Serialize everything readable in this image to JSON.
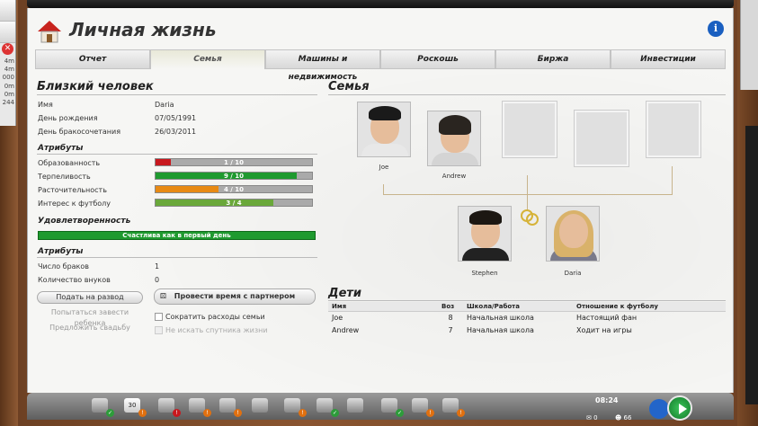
{
  "sidebar_left": {
    "nums": [
      "4m",
      "4m",
      "000",
      "0m",
      "0m",
      "244"
    ]
  },
  "page": {
    "title": "Личная жизнь"
  },
  "tabs": [
    "Отчет",
    "Семья",
    "Машины и недвижимость",
    "Роскошь",
    "Биржа",
    "Инвестиции"
  ],
  "partner": {
    "header": "Близкий человек",
    "rows": [
      {
        "label": "Имя",
        "value": "Daria"
      },
      {
        "label": "День рождения",
        "value": "07/05/1991"
      },
      {
        "label": "День бракосочетания",
        "value": "26/03/2011"
      }
    ],
    "attributes_title": "Атрибуты",
    "attributes": [
      {
        "label": "Образованность",
        "text": "1 / 10",
        "fraction": 0.1,
        "color": "#c8181e"
      },
      {
        "label": "Терпеливость",
        "text": "9 / 10",
        "fraction": 0.9,
        "color": "#1f9a2f"
      },
      {
        "label": "Расточительность",
        "text": "4 / 10",
        "fraction": 0.4,
        "color": "#e88a14"
      },
      {
        "label": "Интерес к футболу",
        "text": "3 / 4",
        "fraction": 0.75,
        "color": "#6aa83a"
      }
    ],
    "satisfaction_title": "Удовлетворенность",
    "satisfaction_text": "Счастлива как в первый день",
    "attributes2_title": "Атрибуты",
    "rows2": [
      {
        "label": "Число браков",
        "value": "1"
      },
      {
        "label": "Количество внуков",
        "value": "0"
      }
    ]
  },
  "actions": {
    "divorce": "Подать на развод",
    "child": "Попытаться завести ребенка",
    "wedding": "Предложить свадьбу",
    "spend_time": "Провести время с партнером",
    "reduce_costs": "Сократить расходы семьи",
    "no_search": "Не искать спутника жизни"
  },
  "family": {
    "header": "Семья",
    "members": [
      {
        "name": "Joe"
      },
      {
        "name": "Andrew"
      },
      {
        "name": "Stephen"
      },
      {
        "name": "Daria"
      }
    ]
  },
  "kids": {
    "header": "Дети",
    "columns": [
      "Имя",
      "Воз",
      "Школа/Работа",
      "Отношение к футболу"
    ],
    "rows": [
      [
        "Joe",
        "8",
        "Начальная школа",
        "Настоящий фан"
      ],
      [
        "Andrew",
        "7",
        "Начальная школа",
        "Ходит на игры"
      ]
    ]
  },
  "dock": {
    "time": "08:24",
    "calendar": "30",
    "mail_count": "0",
    "fans": "66"
  }
}
